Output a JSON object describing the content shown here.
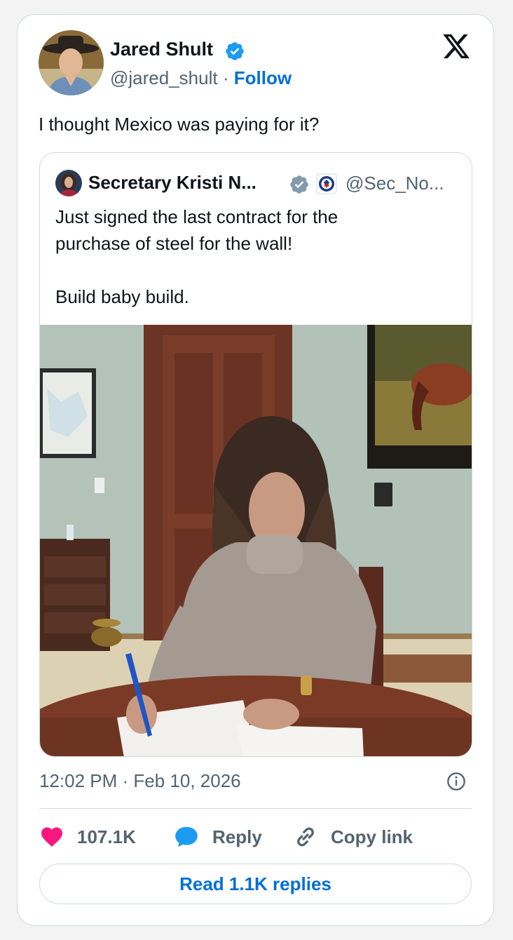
{
  "author": {
    "name": "Jared Shult",
    "handle": "@jared_shult",
    "separator": "·",
    "follow_label": "Follow"
  },
  "tweet": {
    "text": "I thought Mexico was paying for it?"
  },
  "quoted": {
    "name": "Secretary Kristi N...",
    "handle": "@Sec_No...",
    "text_line1": "Just signed the last contract for the",
    "text_line2": "purchase of steel for the wall!",
    "text_line3": "Build baby build."
  },
  "meta": {
    "timestamp": "12:02 PM · Feb 10, 2026"
  },
  "actions": {
    "like_count": "107.1K",
    "reply_label": "Reply",
    "copy_label": "Copy link"
  },
  "read_replies_label": "Read 1.1K replies",
  "colors": {
    "like": "#f91880",
    "reply": "#1d9bf0",
    "link": "#006fd6",
    "verified": "#1d9bf0",
    "muted": "#536471",
    "border": "#cfd9de"
  },
  "icons": [
    "verified-badge-icon",
    "x-logo-icon",
    "government-verified-icon",
    "dhs-seal-icon",
    "info-icon",
    "heart-icon",
    "reply-bubble-icon",
    "link-icon"
  ]
}
